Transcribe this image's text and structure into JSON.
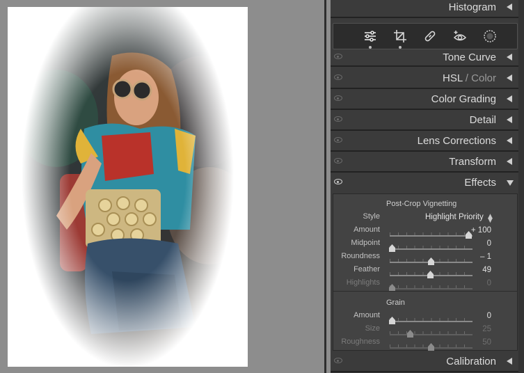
{
  "photo": {
    "alt": "",
    "colors": {
      "denim": "#37506a",
      "bag": "#cdb781",
      "shirt_red": "#b9322a",
      "shirt_teal": "#2f8ea2",
      "hair": "#8a5a33",
      "skin": "#d9a27f"
    }
  },
  "panel": {
    "histogram": "Histogram",
    "tone_curve": "Tone Curve",
    "hsl": "HSL",
    "hsl_sep": " / ",
    "color": "Color",
    "color_grading": "Color Grading",
    "detail": "Detail",
    "lens_corrections": "Lens Corrections",
    "transform": "Transform",
    "effects": "Effects",
    "calibration": "Calibration"
  },
  "tools": [
    {
      "name": "sliders-icon",
      "active": true
    },
    {
      "name": "crop-icon",
      "active": true
    },
    {
      "name": "healing-icon",
      "active": false
    },
    {
      "name": "red-eye-icon",
      "active": false
    },
    {
      "name": "masking-icon",
      "active": false
    }
  ],
  "vignetting": {
    "title": "Post-Crop Vignetting",
    "style_label": "Style",
    "style_value": "Highlight Priority",
    "rows": [
      {
        "label": "Amount",
        "value": "+ 100",
        "level": 0.95,
        "faint": false
      },
      {
        "label": "Midpoint",
        "value": "0",
        "level": 0.03,
        "faint": false
      },
      {
        "label": "Roundness",
        "value": "– 1",
        "level": 0.5,
        "faint": false
      },
      {
        "label": "Feather",
        "value": "49",
        "level": 0.49,
        "faint": false
      },
      {
        "label": "Highlights",
        "value": "0",
        "level": 0.03,
        "faint": true
      }
    ]
  },
  "grain": {
    "title": "Grain",
    "rows": [
      {
        "label": "Amount",
        "value": "0",
        "level": 0.03,
        "faint": false
      },
      {
        "label": "Size",
        "value": "25",
        "level": 0.25,
        "faint": true
      },
      {
        "label": "Roughness",
        "value": "50",
        "level": 0.5,
        "faint": true
      }
    ]
  },
  "colors": {
    "panel_bg": "#3b3b3b",
    "section_bg": "#434343",
    "canvas_bg": "#8d8d8d",
    "text": "#dcdcdc"
  }
}
